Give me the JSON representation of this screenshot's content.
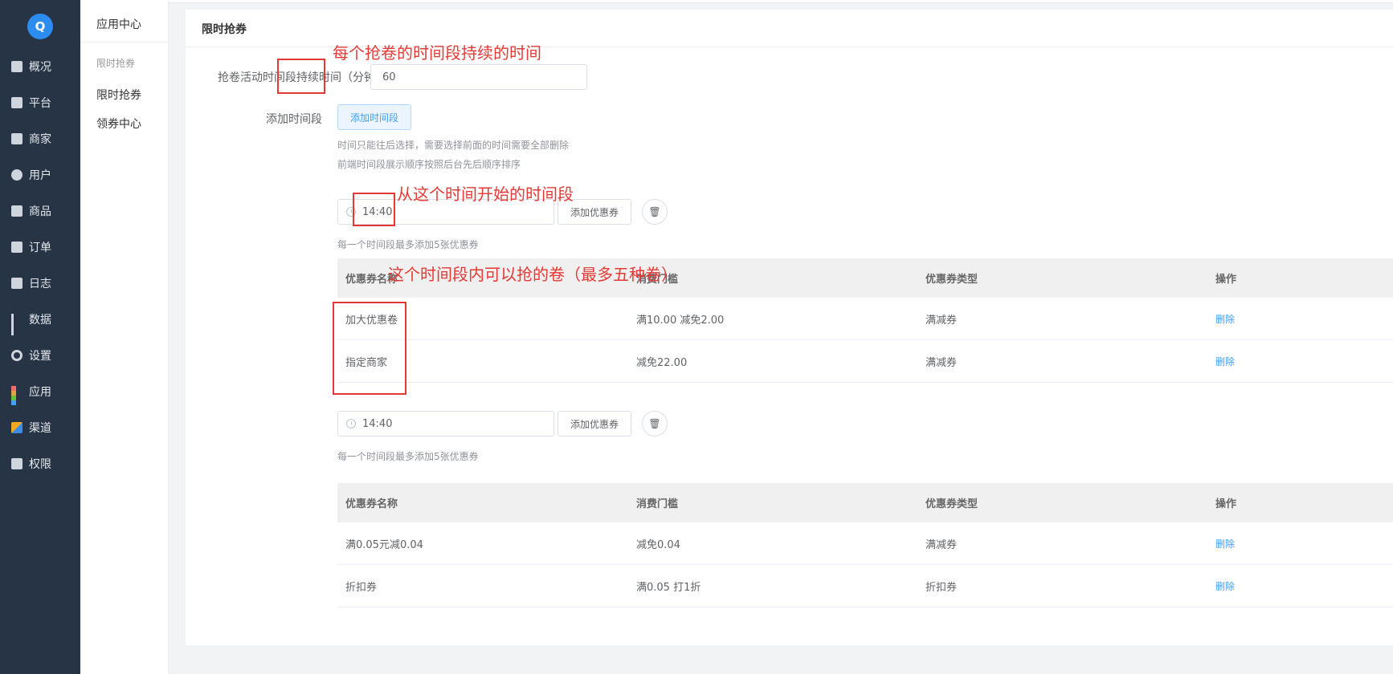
{
  "sidebar": {
    "logo": "Q",
    "items": [
      {
        "label": "概况",
        "icon": "monitor-chart-icon"
      },
      {
        "label": "平台",
        "icon": "display-icon"
      },
      {
        "label": "商家",
        "icon": "store-icon"
      },
      {
        "label": "用户",
        "icon": "user-icon"
      },
      {
        "label": "商品",
        "icon": "product-icon"
      },
      {
        "label": "订单",
        "icon": "order-icon"
      },
      {
        "label": "日志",
        "icon": "log-icon"
      },
      {
        "label": "数据",
        "icon": "bar-chart-icon"
      },
      {
        "label": "设置",
        "icon": "gear-icon"
      },
      {
        "label": "应用",
        "icon": "apps-grid-icon"
      },
      {
        "label": "渠道",
        "icon": "cube-icon"
      },
      {
        "label": "权限",
        "icon": "lock-icon"
      }
    ]
  },
  "subnav": {
    "title": "应用中心",
    "group": "限时抢券",
    "items": [
      "限时抢券",
      "领券中心"
    ]
  },
  "card": {
    "title": "限时抢券",
    "duration_label": "抢卷活动时间段持续时间（分钟）",
    "duration_value": "60",
    "add_period_label": "添加时间段",
    "add_period_button": "添加时间段",
    "hints": [
      "时间只能往后选择，需要选择前面的时间需要全部删除",
      "前端时间段展示顺序按照后台先后顺序排序"
    ]
  },
  "periods": [
    {
      "time": "14:40",
      "add_coupon": "添加优惠券",
      "hint": "每一个时间段最多添加5张优惠券",
      "columns": [
        "优惠券名称",
        "消费门槛",
        "优惠券类型",
        "操作"
      ],
      "rows": [
        {
          "name": "加大优惠卷",
          "threshold": "满10.00 减免2.00",
          "type": "满减券",
          "action": "删除"
        },
        {
          "name": "指定商家",
          "threshold": "减免22.00",
          "type": "满减券",
          "action": "删除"
        }
      ]
    },
    {
      "time": "14:40",
      "add_coupon": "添加优惠券",
      "hint": "每一个时间段最多添加5张优惠券",
      "columns": [
        "优惠券名称",
        "消费门槛",
        "优惠券类型",
        "操作"
      ],
      "rows": [
        {
          "name": "满0.05元减0.04",
          "threshold": "减免0.04",
          "type": "满减券",
          "action": "删除"
        },
        {
          "name": "折扣券",
          "threshold": "满0.05 打1折",
          "type": "折扣券",
          "action": "删除"
        }
      ]
    }
  ],
  "annotations": {
    "a1": "每个抢卷的时间段持续的时间",
    "a2": "从这个时间开始的时间段",
    "a3": "这个时间段内可以抢的卷（最多五种卷）"
  },
  "colors": {
    "sidebar_bg": "#263445",
    "accent": "#409eff",
    "annotation": "#e53935"
  }
}
